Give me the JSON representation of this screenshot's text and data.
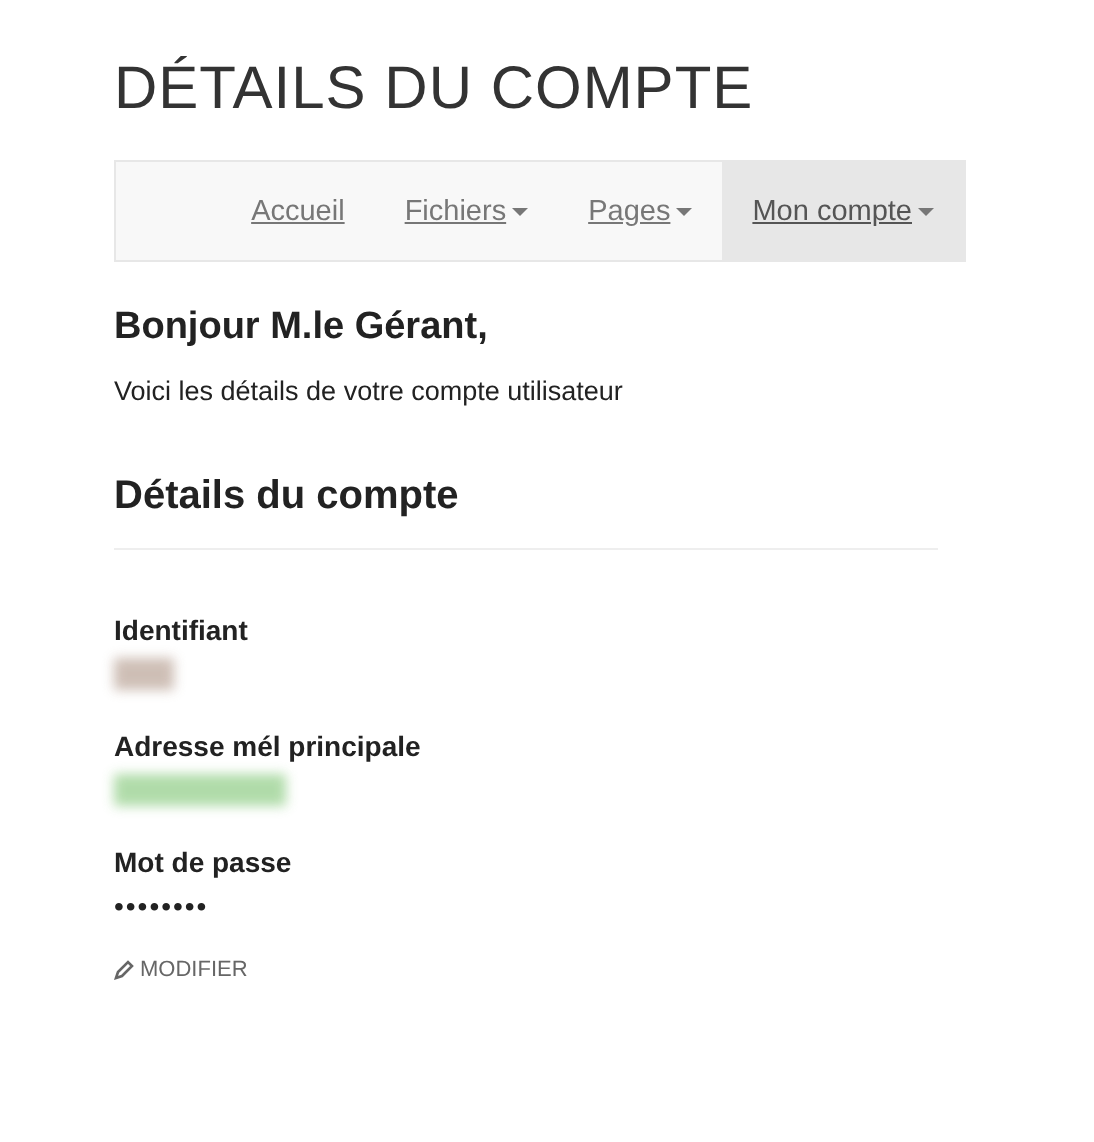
{
  "page_title": "DÉTAILS DU COMPTE",
  "nav": [
    {
      "label": "Accueil",
      "dropdown": false,
      "selected": false
    },
    {
      "label": "Fichiers",
      "dropdown": true,
      "selected": false
    },
    {
      "label": "Pages",
      "dropdown": true,
      "selected": false
    },
    {
      "label": "Mon compte",
      "dropdown": true,
      "selected": true
    }
  ],
  "greeting": "Bonjour M.le Gérant,",
  "intro": "Voici les détails de votre compte utilisateur",
  "section_title": "Détails du compte",
  "fields": [
    {
      "label": "Identifiant",
      "kind": "redacted",
      "color": "#c9b8ae"
    },
    {
      "label": "Adresse mél principale",
      "kind": "redacted",
      "color": "#a8d8a0"
    },
    {
      "label": "Mot de passe",
      "kind": "text",
      "value": "••••••••"
    }
  ],
  "edit_link": "MODIFIER"
}
